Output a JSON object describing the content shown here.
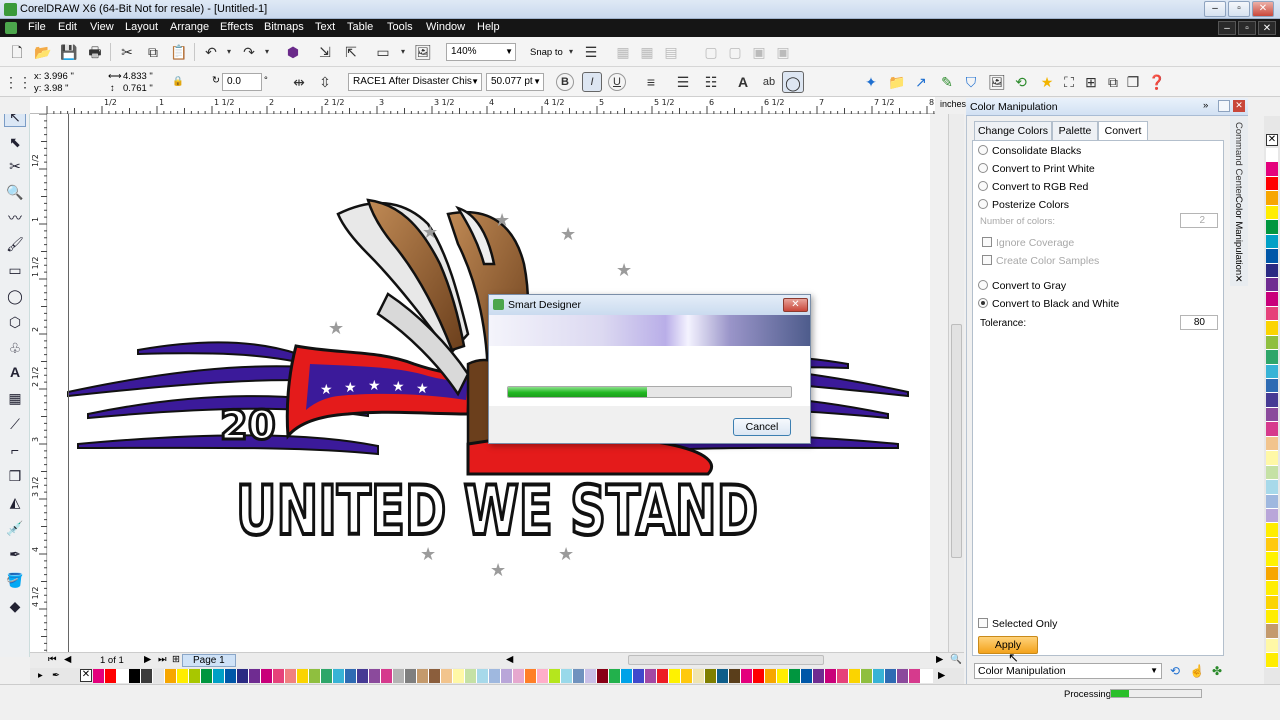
{
  "window": {
    "title": "CorelDRAW X6 (64-Bit Not for resale) - [Untitled-1]"
  },
  "menu": [
    "File",
    "Edit",
    "View",
    "Layout",
    "Arrange",
    "Effects",
    "Bitmaps",
    "Text",
    "Table",
    "Tools",
    "Window",
    "Help"
  ],
  "toolbar": {
    "zoom": "140%",
    "snap_to": "Snap to"
  },
  "property_bar": {
    "x": "x: 3.996 \"",
    "y": "y: 3.98 \"",
    "w": "4.833 \"",
    "h": "0.761 \"",
    "angle": "0.0",
    "angle_unit": "°",
    "font": "RACE1 After Disaster Chis",
    "font_size": "50.077 pt"
  },
  "rulers": {
    "unit": "inches",
    "h_labels": [
      "1/2",
      "1",
      "1 1/2",
      "2",
      "2 1/2",
      "3",
      "3 1/2",
      "4",
      "4 1/2",
      "5",
      "5 1/2",
      "6",
      "6 1/2",
      "7",
      "7 1/2",
      "8"
    ],
    "v_labels": [
      "1/2",
      "1",
      "1 1/2",
      "2",
      "2 1/2",
      "3",
      "3 1/2",
      "4",
      "4 1/2"
    ]
  },
  "artwork": {
    "number": "20",
    "headline": "UNITED WE STAND"
  },
  "page_nav": {
    "counter": "1 of 1",
    "page_tab": "Page 1"
  },
  "docker": {
    "title": "Color Manipulation",
    "side_tabs": [
      "Command Center",
      "Color Manipulation"
    ],
    "tabs": [
      {
        "label": "Change Colors",
        "active": false
      },
      {
        "label": "Palette",
        "active": false
      },
      {
        "label": "Convert",
        "active": true
      }
    ],
    "options": {
      "consolidate": "Consolidate Blacks",
      "print_white": "Convert to Print White",
      "rgb_red": "Convert to RGB Red",
      "posterize": "Posterize Colors",
      "num_colors_label": "Number of colors:",
      "num_colors": "2",
      "ignore_coverage": "Ignore Coverage",
      "create_samples": "Create Color Samples",
      "gray": "Convert to Gray",
      "bw": "Convert to Black and White",
      "tolerance_label": "Tolerance:",
      "tolerance": "80",
      "selected_only": "Selected Only"
    },
    "apply": "Apply",
    "bottom_combo": "Color Manipulation"
  },
  "dialog": {
    "title": "Smart Designer",
    "progress": 0.49,
    "cancel": "Cancel"
  },
  "status": {
    "processing": "Processing",
    "progress": 0.2
  },
  "palette_colors": [
    "#e4007c",
    "#ff0000",
    "#ffffff",
    "#000000",
    "#3b3b3b",
    "#e5e5e5",
    "#f7a600",
    "#ffed00",
    "#a8c700",
    "#00963f",
    "#00a0c6",
    "#0057a8",
    "#2b2a83",
    "#6f2c91",
    "#c9007a",
    "#e6427a",
    "#f08080",
    "#fbd400",
    "#8fbf3f",
    "#2ea66a",
    "#37b3d6",
    "#2e6bb3",
    "#463a94",
    "#8b4a9c",
    "#d63a8d",
    "#b3b3b3",
    "#7f7f7f",
    "#c49a6c",
    "#8b5e3c",
    "#f2c48d",
    "#fff8a6",
    "#c5e1a5",
    "#a7d9ea",
    "#9fb8df",
    "#b9a6d9",
    "#e6a8cf",
    "#ff7f27",
    "#ffaec9",
    "#b5e61d",
    "#99d9ea",
    "#7092be",
    "#c8bfe7",
    "#880015",
    "#22b14c",
    "#00a2e8",
    "#3f48cc",
    "#a349a4",
    "#ed1c24",
    "#fff200",
    "#ffc90e",
    "#efe4b0",
    "#7f7f00",
    "#0f5e8a",
    "#5a3e1b",
    "#e4007c",
    "#ff0000",
    "#f7a600",
    "#ffed00",
    "#00963f",
    "#0057a8",
    "#6f2c91",
    "#c9007a",
    "#e6427a",
    "#fbd400",
    "#8fbf3f",
    "#37b3d6",
    "#2e6bb3",
    "#8b4a9c",
    "#d63a8d",
    "#ffffff"
  ],
  "palette_right": [
    "#ffffff",
    "#e4007c",
    "#ff0000",
    "#f7a600",
    "#ffed00",
    "#00963f",
    "#00a0c6",
    "#0057a8",
    "#2b2a83",
    "#6f2c91",
    "#c9007a",
    "#e6427a",
    "#fbd400",
    "#8fbf3f",
    "#2ea66a",
    "#37b3d6",
    "#2e6bb3",
    "#463a94",
    "#8b4a9c",
    "#d63a8d",
    "#f2c48d",
    "#fff8a6",
    "#c5e1a5",
    "#a7d9ea",
    "#9fb8df",
    "#b9a6d9",
    "#ffed00",
    "#ffc90e",
    "#fff200",
    "#f7a600",
    "#ffed00",
    "#fbd400",
    "#ffed00",
    "#c49a6c",
    "#fff8a6",
    "#ffed00"
  ],
  "colors": {
    "accent_orange": "#f3a21c",
    "progress_green": "#21b821",
    "eagle_brown": "#8b5a2b",
    "flag_red": "#e41b1b",
    "stripe_purple": "#3b1a9a"
  }
}
